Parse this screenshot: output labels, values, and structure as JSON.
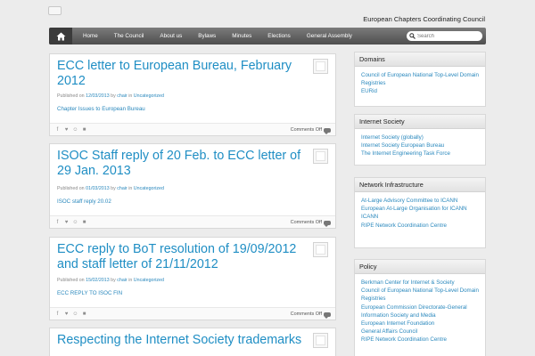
{
  "header": {
    "site_title": "European Chapters Coordinating Council"
  },
  "nav": {
    "items": [
      "Home",
      "The Council",
      "About us",
      "Bylaws",
      "Minutes",
      "Elections",
      "General Assembly"
    ],
    "search_placeholder": "Search"
  },
  "posts": [
    {
      "title": "ECC letter to European Bureau, February 2012",
      "published_label": "Published on",
      "date": "12/03/2013",
      "by_label": "by",
      "author": "chair",
      "in_label": "in",
      "category": "Uncategorized",
      "link": "Chapter Issues to European Bureau",
      "comments": "Comments Off"
    },
    {
      "title": "ISOC Staff reply of 20 Feb. to ECC letter of 29 Jan. 2013",
      "published_label": "Published on",
      "date": "01/03/2013",
      "by_label": "by",
      "author": "chair",
      "in_label": "in",
      "category": "Uncategorized",
      "link": "ISOC staff reply 20.02",
      "comments": "Comments Off"
    },
    {
      "title": "ECC reply to BoT resolution of 19/09/2012 and staff letter of 21/11/2012",
      "published_label": "Published on",
      "date": "15/02/2013",
      "by_label": "by",
      "author": "chair",
      "in_label": "in",
      "category": "Uncategorized",
      "link": "ECC REPLY TO ISOC FIN",
      "comments": "Comments Off"
    },
    {
      "title": "Respecting the Internet Society trademarks"
    }
  ],
  "sidebar": {
    "domains": {
      "title": "Domains",
      "items": [
        "Council of European National Top-Level Domain Registries",
        "EURid"
      ]
    },
    "internet_society": {
      "title": "Internet Society",
      "items": [
        "Internet Society (globally)",
        "Internet Society European Bureau",
        "The Internet Engineering Task Force"
      ]
    },
    "network_infrastructure": {
      "title": "Network Infrastructure",
      "items": [
        "At-Large Advisory Committee to ICANN",
        "European At-Large Organisation for ICANN",
        "ICANN",
        "RIPE Network Coordination Centre"
      ]
    },
    "policy": {
      "title": "Policy",
      "items": [
        "Berkman Center for Internet & Society",
        "Council of European National Top-Level Domain Registries",
        "European Commission Directorate-General Information Society and Media",
        "European Internet Foundation",
        "General Affairs Council",
        "RIPE Network Coordination Centre"
      ]
    }
  }
}
